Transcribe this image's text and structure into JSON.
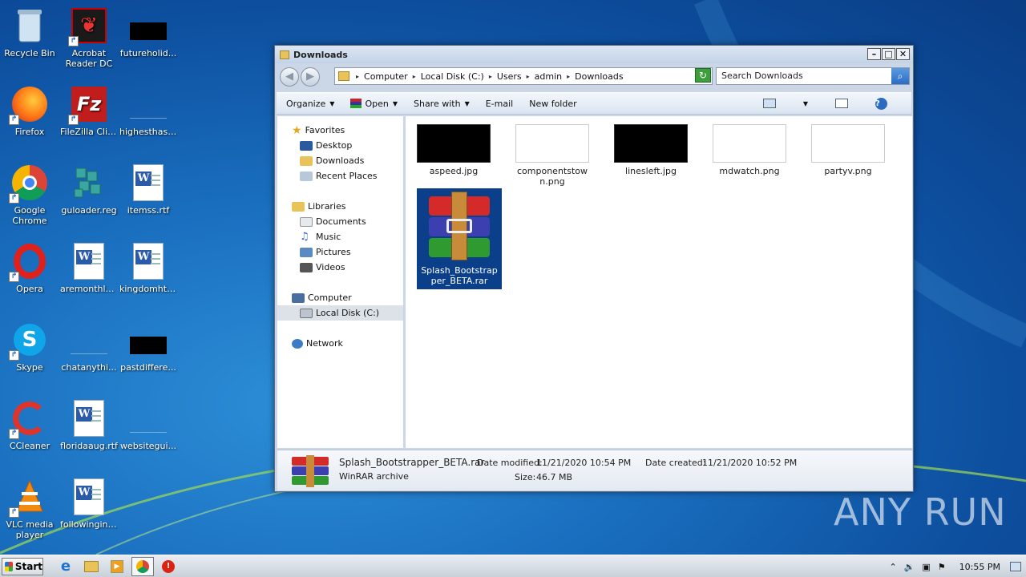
{
  "desktop": {
    "icons": [
      {
        "label": "Recycle Bin"
      },
      {
        "label": "Acrobat Reader DC"
      },
      {
        "label": "futureholid..."
      },
      {
        "label": "Firefox"
      },
      {
        "label": "FileZilla Client"
      },
      {
        "label": "highesthas...."
      },
      {
        "label": "Google Chrome"
      },
      {
        "label": "guloader.reg"
      },
      {
        "label": "itemss.rtf"
      },
      {
        "label": "Opera"
      },
      {
        "label": "aremonthly.rtf"
      },
      {
        "label": "kingdomhtml..."
      },
      {
        "label": "Skype"
      },
      {
        "label": "chatanythi..."
      },
      {
        "label": "pastdiffere..."
      },
      {
        "label": "CCleaner"
      },
      {
        "label": "floridaaug.rtf"
      },
      {
        "label": "websitegui..."
      },
      {
        "label": "VLC media player"
      },
      {
        "label": "followingin.rtf"
      }
    ]
  },
  "window": {
    "title": "Downloads",
    "address": [
      "Computer",
      "Local Disk (C:)",
      "Users",
      "admin",
      "Downloads"
    ],
    "search_placeholder": "Search Downloads",
    "toolbar": {
      "organize": "Organize",
      "open": "Open",
      "share": "Share with",
      "email": "E-mail",
      "new_folder": "New folder"
    },
    "nav": {
      "favorites": "Favorites",
      "desktop": "Desktop",
      "downloads": "Downloads",
      "recent": "Recent Places",
      "libraries": "Libraries",
      "documents": "Documents",
      "music": "Music",
      "pictures": "Pictures",
      "videos": "Videos",
      "computer": "Computer",
      "local_disk": "Local Disk (C:)",
      "network": "Network"
    },
    "files": [
      {
        "name": "aspeed.jpg"
      },
      {
        "name": "componentstown.png"
      },
      {
        "name": "linesleft.jpg"
      },
      {
        "name": "mdwatch.png"
      },
      {
        "name": "partyv.png"
      },
      {
        "name": "Splash_Bootstrapper_BETA.rar"
      }
    ],
    "details": {
      "name": "Splash_Bootstrapper_BETA.rar",
      "type": "WinRAR archive",
      "modified_label": "Date modified:",
      "modified": "11/21/2020 10:54 PM",
      "created_label": "Date created:",
      "created": "11/21/2020 10:52 PM",
      "size_label": "Size:",
      "size": "46.7 MB"
    }
  },
  "taskbar": {
    "start": "Start",
    "time": "10:55 PM"
  },
  "watermark": "ANY RUN"
}
